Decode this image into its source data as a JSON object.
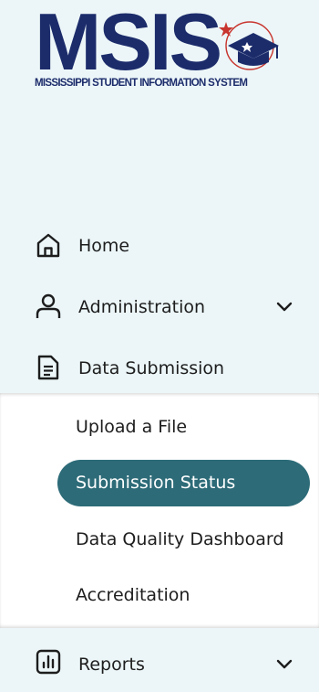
{
  "logo": {
    "title": "MSIS",
    "subtitle": "MISSISSIPPI STUDENT INFORMATION SYSTEM",
    "icon": "graduation-cap-star-icon",
    "colors": {
      "navy": "#1c2c6b",
      "red": "#c8352e"
    }
  },
  "nav": {
    "home": {
      "label": "Home",
      "icon": "home-icon"
    },
    "administration": {
      "label": "Administration",
      "icon": "user-icon",
      "chevron": "chevron-down-icon"
    },
    "data_submission": {
      "label": "Data Submission",
      "icon": "document-icon"
    },
    "reports": {
      "label": "Reports",
      "icon": "bar-chart-icon",
      "chevron": "chevron-down-icon"
    }
  },
  "submenu": {
    "items": [
      {
        "label": "Upload a File"
      },
      {
        "label": "Submission Status",
        "active": true
      },
      {
        "label": "Data Quality Dashboard"
      },
      {
        "label": "Accreditation"
      }
    ]
  },
  "colors": {
    "sidebar_bg": "#ecf6f8",
    "submenu_bg": "#ffffff",
    "active_pill": "#2d6b78",
    "text": "#1d1d1d"
  }
}
